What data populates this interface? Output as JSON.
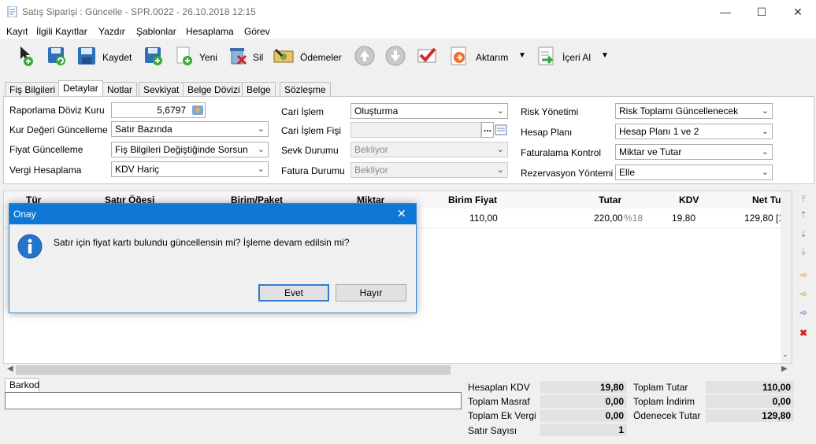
{
  "window": {
    "title": "Satış Siparişi : Güncelle - SPR.0022 - 26.10.2018 12:15",
    "minimize": "—",
    "maximize": "☐",
    "close": "✕"
  },
  "menu": [
    "Kayıt",
    "İlgili Kayıtlar",
    "Yazdır",
    "Şablonlar",
    "Hesaplama",
    "Görev"
  ],
  "toolbar": {
    "save": "Kaydet",
    "new": "Yeni",
    "delete": "Sil",
    "payments": "Ödemeler",
    "transfer": "Aktarım",
    "import": "İçeri Al",
    "dropdown_glyph": "▼"
  },
  "tabs": [
    "Fiş Bilgileri",
    "Detaylar",
    "Notlar",
    "Sevkiyat",
    "Belge Dövizi",
    "Belge",
    "Sözleşme"
  ],
  "form": {
    "report_currency_label": "Raporlama Döviz Kuru",
    "report_currency_value": "5,6797",
    "rate_update_label": "Kur Değeri Güncelleme",
    "rate_update_value": "Satır Bazında",
    "price_update_label": "Fiyat Güncelleme",
    "price_update_value": "Fiş Bilgileri Değiştiğinde Sorsun",
    "tax_calc_label": "Vergi Hesaplama",
    "tax_calc_value": "KDV Hariç",
    "account_tx_label": "Cari İşlem",
    "account_tx_value": "Oluşturma",
    "account_slip_label": "Cari İşlem Fişi",
    "account_slip_value": "",
    "account_slip_button": "...",
    "shipping_status_label": "Sevk Durumu",
    "shipping_status_value": "Bekliyor",
    "invoice_status_label": "Fatura Durumu",
    "invoice_status_value": "Bekliyor",
    "risk_label": "Risk Yönetimi",
    "risk_value": "Risk Toplamı Güncellenecek",
    "account_plan_label": "Hesap Planı",
    "account_plan_value": "Hesap Planı 1 ve 2",
    "invoicing_control_label": "Faturalama Kontrol",
    "invoicing_control_value": "Miktar ve Tutar",
    "reservation_label": "Rezervasyon Yöntemi",
    "reservation_value": "Elle"
  },
  "grid": {
    "columns": [
      "Tür",
      "Satır Öğesi",
      "Birim/Paket",
      "Miktar",
      "Birim Fiyat",
      "Tutar",
      "KDV",
      "Net Tu"
    ],
    "row": {
      "unit_price": "110,00",
      "amount": "220,00",
      "vat_rate": "%18",
      "vat": "19,80",
      "net": "129,80 [1"
    }
  },
  "barcode": {
    "tab": "Barkod",
    "value": ""
  },
  "summary": {
    "calc_vat_label": "Hesaplan KDV",
    "calc_vat": "19,80",
    "total_expense_label": "Toplam Masraf",
    "total_expense": "0,00",
    "total_extra_tax_label": "Toplam Ek Vergi",
    "total_extra_tax": "0,00",
    "row_count_label": "Satır Sayısı",
    "row_count": "1",
    "total_amount_label": "Toplam Tutar",
    "total_amount": "110,00",
    "total_discount_label": "Toplam İndirim",
    "total_discount": "0,00",
    "payable_label": "Ödenecek Tutar",
    "payable": "129,80"
  },
  "dialog": {
    "title": "Onay",
    "message": "Satır için fiyat kartı bulundu güncellensin mi? İşleme devam edilsin mi?",
    "yes": "Evet",
    "no": "Hayır",
    "close": "✕",
    "icon_glyph": "i"
  },
  "colors": {
    "dialog_title": "#0f78d7",
    "grid_header": "#cde4f7"
  }
}
